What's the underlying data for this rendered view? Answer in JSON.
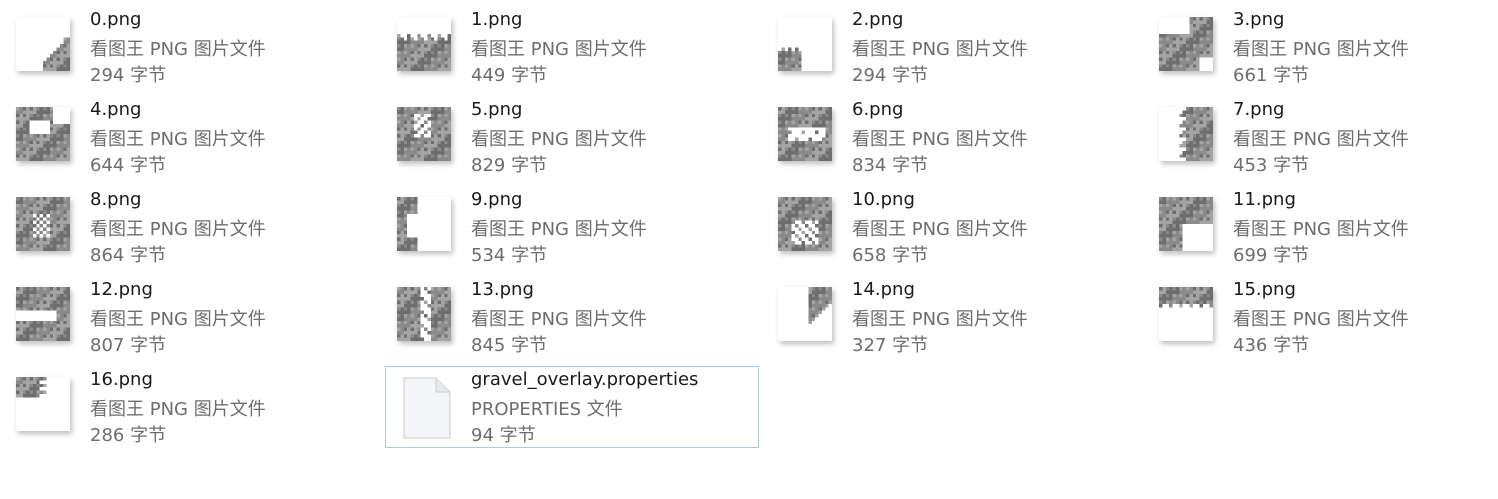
{
  "files": [
    {
      "name": "0.png",
      "type": "看图王 PNG 图片文件",
      "size": "294 字节",
      "icon": "png-thumbnail",
      "pattern": 0
    },
    {
      "name": "1.png",
      "type": "看图王 PNG 图片文件",
      "size": "449 字节",
      "icon": "png-thumbnail",
      "pattern": 1
    },
    {
      "name": "2.png",
      "type": "看图王 PNG 图片文件",
      "size": "294 字节",
      "icon": "png-thumbnail",
      "pattern": 2
    },
    {
      "name": "3.png",
      "type": "看图王 PNG 图片文件",
      "size": "661 字节",
      "icon": "png-thumbnail",
      "pattern": 3
    },
    {
      "name": "4.png",
      "type": "看图王 PNG 图片文件",
      "size": "644 字节",
      "icon": "png-thumbnail",
      "pattern": 4
    },
    {
      "name": "5.png",
      "type": "看图王 PNG 图片文件",
      "size": "829 字节",
      "icon": "png-thumbnail",
      "pattern": 5
    },
    {
      "name": "6.png",
      "type": "看图王 PNG 图片文件",
      "size": "834 字节",
      "icon": "png-thumbnail",
      "pattern": 6
    },
    {
      "name": "7.png",
      "type": "看图王 PNG 图片文件",
      "size": "453 字节",
      "icon": "png-thumbnail",
      "pattern": 7
    },
    {
      "name": "8.png",
      "type": "看图王 PNG 图片文件",
      "size": "864 字节",
      "icon": "png-thumbnail",
      "pattern": 8
    },
    {
      "name": "9.png",
      "type": "看图王 PNG 图片文件",
      "size": "534 字节",
      "icon": "png-thumbnail",
      "pattern": 9
    },
    {
      "name": "10.png",
      "type": "看图王 PNG 图片文件",
      "size": "658 字节",
      "icon": "png-thumbnail",
      "pattern": 10
    },
    {
      "name": "11.png",
      "type": "看图王 PNG 图片文件",
      "size": "699 字节",
      "icon": "png-thumbnail",
      "pattern": 11
    },
    {
      "name": "12.png",
      "type": "看图王 PNG 图片文件",
      "size": "807 字节",
      "icon": "png-thumbnail",
      "pattern": 12
    },
    {
      "name": "13.png",
      "type": "看图王 PNG 图片文件",
      "size": "845 字节",
      "icon": "png-thumbnail",
      "pattern": 13
    },
    {
      "name": "14.png",
      "type": "看图王 PNG 图片文件",
      "size": "327 字节",
      "icon": "png-thumbnail",
      "pattern": 14
    },
    {
      "name": "15.png",
      "type": "看图王 PNG 图片文件",
      "size": "436 字节",
      "icon": "png-thumbnail",
      "pattern": 15
    },
    {
      "name": "16.png",
      "type": "看图王 PNG 图片文件",
      "size": "286 字节",
      "icon": "png-thumbnail",
      "pattern": 16
    },
    {
      "name": "gravel_overlay.properties",
      "type": "PROPERTIES 文件",
      "size": "94 字节",
      "icon": "document-icon",
      "selected": true
    }
  ],
  "colors": {
    "selection_border": "#9fd3ea",
    "gravel_dark": "#6e6e6e",
    "gravel_mid": "#8a8a8a",
    "gravel_light": "#a4a4a4"
  }
}
